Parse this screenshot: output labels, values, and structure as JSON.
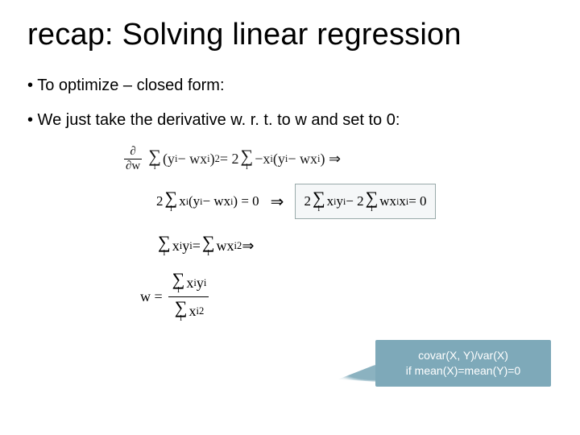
{
  "title": "recap: Solving linear regression",
  "bullets": {
    "b1": "• To optimize – closed form:",
    "b2": "• We just take the derivative w. r. t. to w and set to 0:"
  },
  "eq1": {
    "dnum": "∂",
    "dden": "∂w",
    "sigma": "∑",
    "sub_i": "i",
    "lhs": "(y",
    "lhs2": " − wx",
    "lhs3": ")",
    "sq": "2",
    "eq": " = 2",
    "rhs1": "−x",
    "rhs2": "(y",
    "rhs3": " − wx",
    "rhs4": ") ⇒",
    "xi": "i"
  },
  "eq2": {
    "left": "2",
    "sigma": "∑",
    "sub_i": "i",
    "body1": "x",
    "body2": "(y",
    "body3": " − wx",
    "body4": ") = 0",
    "arrow": "⇒",
    "box_l": "2",
    "box_mid1": "x",
    "box_mid2": "y",
    "box_minus": " − 2",
    "box_mid3": "wx",
    "box_mid4": "x",
    "box_end": " = 0",
    "xi": "i"
  },
  "eq3": {
    "sigma": "∑",
    "sub_i": "i",
    "l1": "x",
    "l2": "y",
    "eq": " = ",
    "r1": "wx",
    "sq": "2",
    "arrow": " ⇒",
    "xi": "i"
  },
  "eq4": {
    "w": "w = ",
    "sigma": "∑",
    "sub_i": "i",
    "num1": "x",
    "num2": "y",
    "den1": "x",
    "sq": "2",
    "xi": "i"
  },
  "callout": {
    "line1": "covar(X, Y)/var(X)",
    "line2": "if mean(X)=mean(Y)=0"
  }
}
